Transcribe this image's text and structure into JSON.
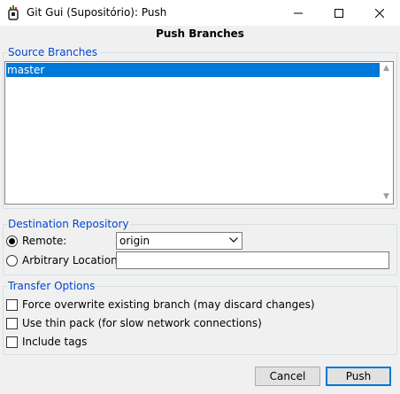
{
  "window": {
    "title": "Git Gui (Supositório): Push",
    "icons": [
      "git-gui-icon",
      "minimize-icon",
      "maximize-icon",
      "close-icon"
    ]
  },
  "heading": "Push Branches",
  "source_branches": {
    "legend": "Source Branches",
    "items": [
      {
        "label": "master",
        "selected": true
      }
    ]
  },
  "destination": {
    "legend": "Destination Repository",
    "remote_label": "Remote:",
    "remote_selected": true,
    "remote_value": "origin",
    "arbitrary_label": "Arbitrary Location:",
    "arbitrary_value": ""
  },
  "transfer": {
    "legend": "Transfer Options",
    "options": [
      {
        "label": "Force overwrite existing branch (may discard changes)",
        "checked": false
      },
      {
        "label": "Use thin pack (for slow network connections)",
        "checked": false
      },
      {
        "label": "Include tags",
        "checked": false
      }
    ]
  },
  "buttons": {
    "cancel": "Cancel",
    "push": "Push"
  },
  "colors": {
    "accent": "#0078d7",
    "legend": "#0046d5",
    "background": "#f0f0f0"
  }
}
